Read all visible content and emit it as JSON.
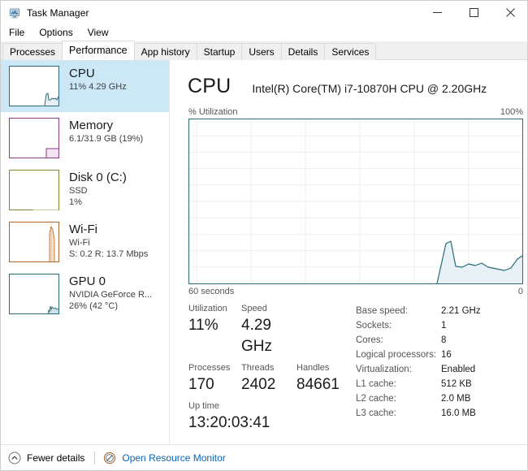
{
  "window": {
    "title": "Task Manager",
    "icon": "task-manager-icon",
    "controls": {
      "minimize": "minimize-icon",
      "maximize": "maximize-icon",
      "close": "close-icon"
    }
  },
  "menu": {
    "items": [
      "File",
      "Options",
      "View"
    ]
  },
  "tabs": {
    "items": [
      {
        "label": "Processes",
        "active": false
      },
      {
        "label": "Performance",
        "active": true
      },
      {
        "label": "App history",
        "active": false
      },
      {
        "label": "Startup",
        "active": false
      },
      {
        "label": "Users",
        "active": false
      },
      {
        "label": "Details",
        "active": false
      },
      {
        "label": "Services",
        "active": false
      }
    ]
  },
  "sidebar": {
    "items": [
      {
        "name": "CPU",
        "title": "CPU",
        "line2": "11%  4.29 GHz",
        "line3": "",
        "color": "#2b6a78",
        "selected": true
      },
      {
        "name": "Memory",
        "title": "Memory",
        "line2": "6.1/31.9 GB (19%)",
        "line3": "",
        "color": "#8a3a8a",
        "selected": false
      },
      {
        "name": "Disk 0 (C:)",
        "title": "Disk 0 (C:)",
        "line2": "SSD",
        "line3": "1%",
        "color": "#7a8a3a",
        "selected": false
      },
      {
        "name": "Wi-Fi",
        "title": "Wi-Fi",
        "line2": "Wi-Fi",
        "line3": "S: 0.2 R: 13.7 Mbps",
        "color": "#b0652a",
        "selected": false
      },
      {
        "name": "GPU 0",
        "title": "GPU 0",
        "line2": "NVIDIA GeForce R...",
        "line3": "26%  (42 °C)",
        "color": "#2b6a78",
        "selected": false
      }
    ]
  },
  "main": {
    "heading": "CPU",
    "model": "Intel(R) Core(TM) i7-10870H CPU @ 2.20GHz",
    "graph_top_left": "% Utilization",
    "graph_top_right": "100%",
    "graph_bottom_left": "60 seconds",
    "graph_bottom_right": "0",
    "accent": "#2b6a78",
    "fill": "#e6f0f5"
  },
  "chart_data": {
    "type": "line",
    "title": "% Utilization",
    "xlabel": "60 seconds",
    "ylabel": "% Utilization",
    "xlim": [
      60,
      0
    ],
    "ylim": [
      0,
      100
    ],
    "grid": true,
    "legend": "none",
    "x": [
      60,
      57,
      54,
      51,
      48,
      45,
      42,
      39,
      36,
      33,
      30,
      27,
      24,
      21,
      18,
      15,
      12,
      9,
      6,
      3,
      0
    ],
    "values": [
      0,
      0,
      0,
      0,
      0,
      0,
      0,
      0,
      0,
      0,
      0,
      0,
      0,
      0,
      24,
      10,
      12,
      11,
      9,
      8,
      14
    ],
    "series": [
      {
        "name": "CPU utilization",
        "values": [
          0,
          0,
          0,
          0,
          0,
          0,
          0,
          0,
          0,
          0,
          0,
          0,
          0,
          0,
          24,
          10,
          12,
          11,
          9,
          8,
          14
        ]
      }
    ]
  },
  "stats": {
    "row1_labels": [
      "Utilization",
      "Speed"
    ],
    "row1_values": [
      "11%",
      "4.29 GHz"
    ],
    "row2_labels": [
      "Processes",
      "Threads",
      "Handles"
    ],
    "row2_values": [
      "170",
      "2402",
      "84661"
    ],
    "uptime_label": "Up time",
    "uptime_value": "13:20:03:41"
  },
  "specs": {
    "rows": [
      {
        "key": "Base speed:",
        "value": "2.21 GHz"
      },
      {
        "key": "Sockets:",
        "value": "1"
      },
      {
        "key": "Cores:",
        "value": "8"
      },
      {
        "key": "Logical processors:",
        "value": "16"
      },
      {
        "key": "Virtualization:",
        "value": "Enabled"
      },
      {
        "key": "L1 cache:",
        "value": "512 KB"
      },
      {
        "key": "L2 cache:",
        "value": "2.0 MB"
      },
      {
        "key": "L3 cache:",
        "value": "16.0 MB"
      }
    ]
  },
  "footer": {
    "fewer_details": "Fewer details",
    "fewer_details_icon": "chevron-up-circle-icon",
    "resource_monitor": "Open Resource Monitor",
    "resource_monitor_icon": "resource-monitor-icon",
    "link_color": "#0a64b4"
  }
}
